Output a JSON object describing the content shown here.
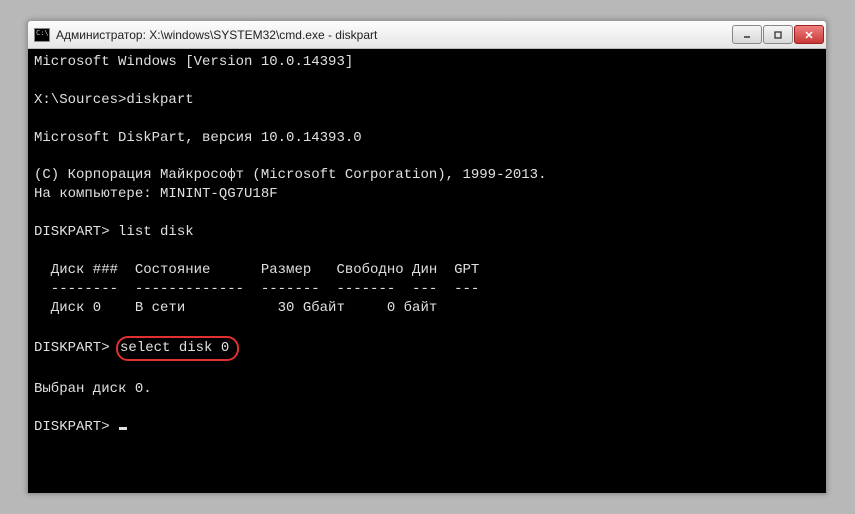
{
  "window": {
    "title": "Администратор: X:\\windows\\SYSTEM32\\cmd.exe - diskpart"
  },
  "terminal": {
    "line_version": "Microsoft Windows [Version 10.0.14393]",
    "prompt_sources": "X:\\Sources>",
    "cmd_diskpart": "diskpart",
    "line_diskpart_version": "Microsoft DiskPart, версия 10.0.14393.0",
    "line_copyright": "(C) Корпорация Майкрософт (Microsoft Corporation), 1999-2013.",
    "line_computer": "На компьютере: MININT-QG7U18F",
    "prompt_diskpart": "DISKPART> ",
    "cmd_listdisk": "list disk",
    "table_header": "  Диск ###  Состояние      Размер   Свободно Дин  GPT",
    "table_divider": "  --------  -------------  -------  -------  ---  ---",
    "table_row0": "  Диск 0    В сети           30 Gбайт     0 байт",
    "cmd_selectdisk": "select disk 0",
    "line_selected": "Выбран диск 0."
  }
}
